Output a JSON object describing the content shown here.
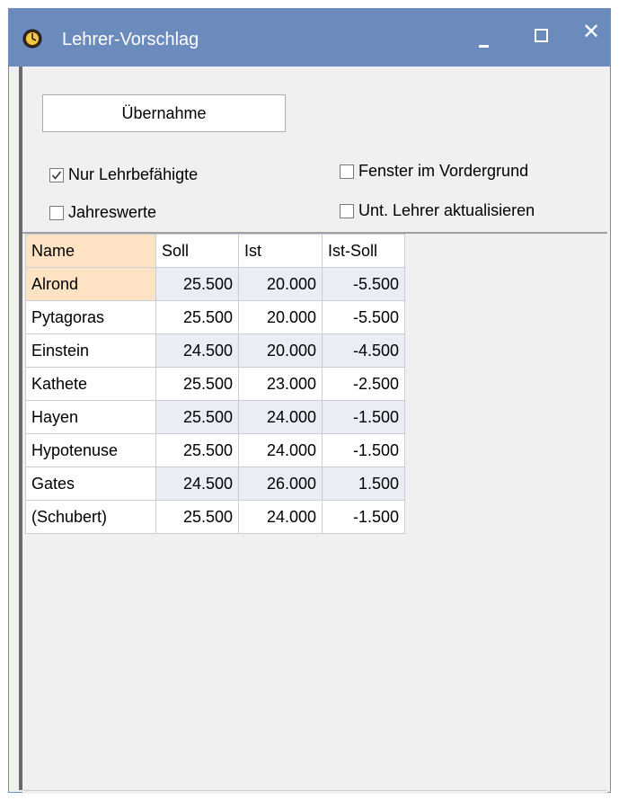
{
  "window": {
    "title": "Lehrer-Vorschlag",
    "close_glyph": "✕"
  },
  "controls": {
    "uebernahme_label": "Übernahme",
    "nur_lehrbefaehigte_label": "Nur Lehrbefähigte",
    "nur_lehrbefaehigte_checked": true,
    "jahreswerte_label": "Jahreswerte",
    "jahreswerte_checked": false,
    "fenster_vordergrund_label": "Fenster im Vordergrund",
    "fenster_vordergrund_checked": false,
    "unt_lehrer_label": "Unt. Lehrer aktualisieren",
    "unt_lehrer_checked": false
  },
  "table": {
    "headers": [
      "Name",
      "Soll",
      "Ist",
      "Ist-Soll"
    ],
    "rows": [
      {
        "name": "Alrond",
        "soll": "25.500",
        "ist": "20.000",
        "diff": "-5.500"
      },
      {
        "name": "Pytagoras",
        "soll": "25.500",
        "ist": "20.000",
        "diff": "-5.500"
      },
      {
        "name": "Einstein",
        "soll": "24.500",
        "ist": "20.000",
        "diff": "-4.500"
      },
      {
        "name": "Kathete",
        "soll": "25.500",
        "ist": "23.000",
        "diff": "-2.500"
      },
      {
        "name": "Hayen",
        "soll": "25.500",
        "ist": "24.000",
        "diff": "-1.500"
      },
      {
        "name": "Hypotenuse",
        "soll": "25.500",
        "ist": "24.000",
        "diff": "-1.500"
      },
      {
        "name": "Gates",
        "soll": "24.500",
        "ist": "26.000",
        "diff": "1.500"
      },
      {
        "name": "(Schubert)",
        "soll": "25.500",
        "ist": "24.000",
        "diff": "-1.500"
      }
    ]
  },
  "colors": {
    "titlebar": "#6b8bbd",
    "selection": "#fde3c3",
    "alt_cell": "#e9edf5"
  },
  "icons": {
    "app": "clock-icon",
    "minimize": "minimize-icon",
    "maximize": "maximize-icon",
    "close": "close-icon",
    "checkmark": "checkmark-icon"
  }
}
